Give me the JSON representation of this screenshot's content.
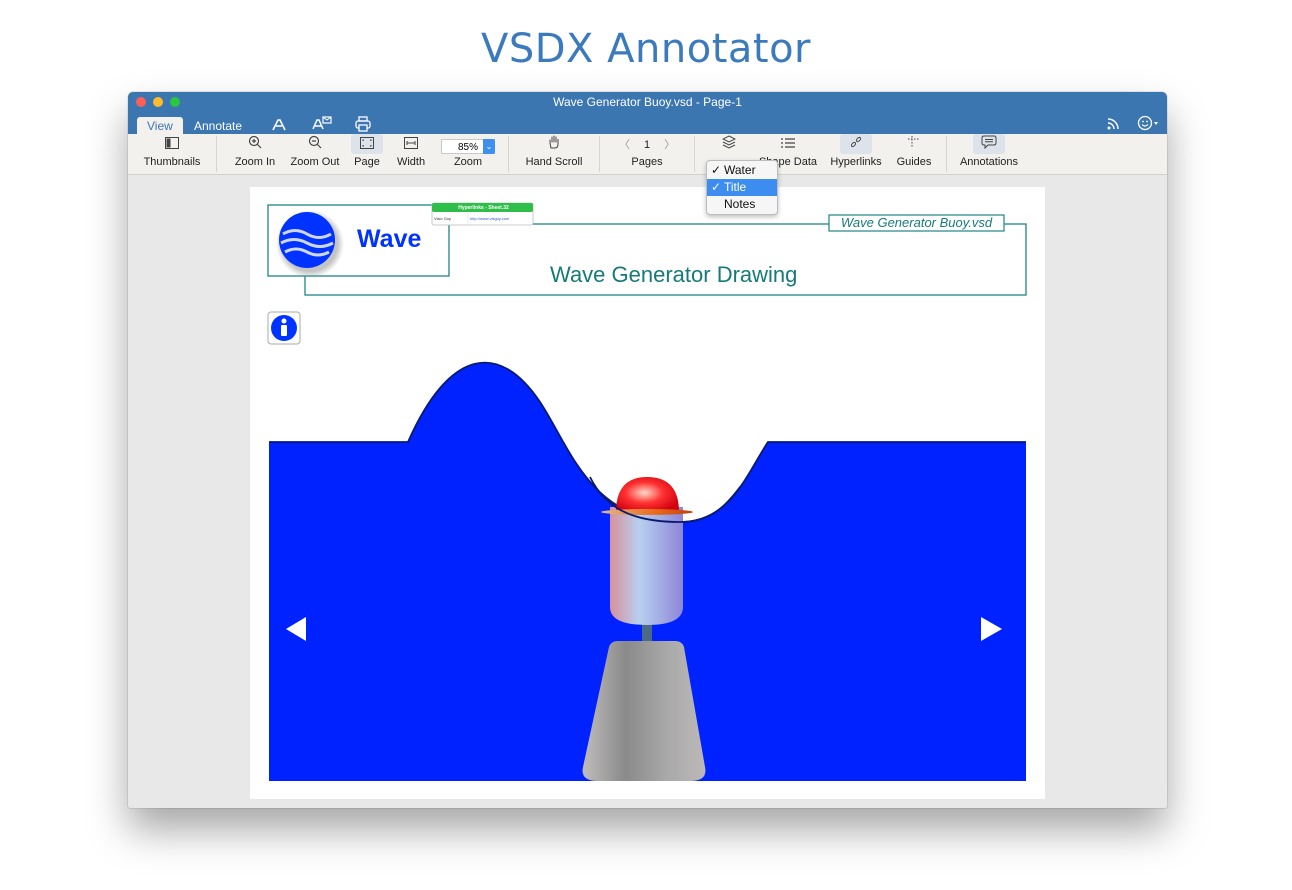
{
  "hero": {
    "title": "VSDX Annotator"
  },
  "window": {
    "title": "Wave Generator Buoy.vsd - Page-1",
    "tabs": [
      {
        "label": "View",
        "active": true
      },
      {
        "label": "Annotate",
        "active": false
      }
    ],
    "tab_icons": [
      "acrobat-icon",
      "acrobat-mail-icon",
      "print-icon"
    ],
    "right_icons": [
      "rss-icon",
      "smiley-account-icon"
    ]
  },
  "toolbar": {
    "thumbnails": "Thumbnails",
    "zoom_in": "Zoom In",
    "zoom_out": "Zoom Out",
    "page": "Page",
    "width": "Width",
    "zoom": "Zoom",
    "zoom_value": "85%",
    "hand_scroll": "Hand Scroll",
    "pages": "Pages",
    "page_number": "1",
    "shape_data": "Shape Data",
    "shape_data_visible": "ape Data",
    "hyperlinks": "Hyperlinks",
    "guides": "Guides",
    "annotations": "Annotations"
  },
  "layers_menu": {
    "items": [
      {
        "label": "Water",
        "checked": true,
        "highlighted": false
      },
      {
        "label": "Title",
        "checked": true,
        "highlighted": true
      },
      {
        "label": "Notes",
        "checked": false,
        "highlighted": false
      }
    ]
  },
  "drawing": {
    "logo_text": "Wave",
    "file_label": "Wave Generator Buoy.vsd",
    "title": "Wave Generator Drawing",
    "hyperlink_popup": {
      "header": "Hyperlinks - Sheet.32",
      "name": "Visio Guy",
      "url": "http://www.visguy.com"
    },
    "colors": {
      "water": "#0022ff",
      "frame": "#1f8585",
      "title_text": "#167a7a",
      "popup_header": "#2fbe4a"
    }
  }
}
